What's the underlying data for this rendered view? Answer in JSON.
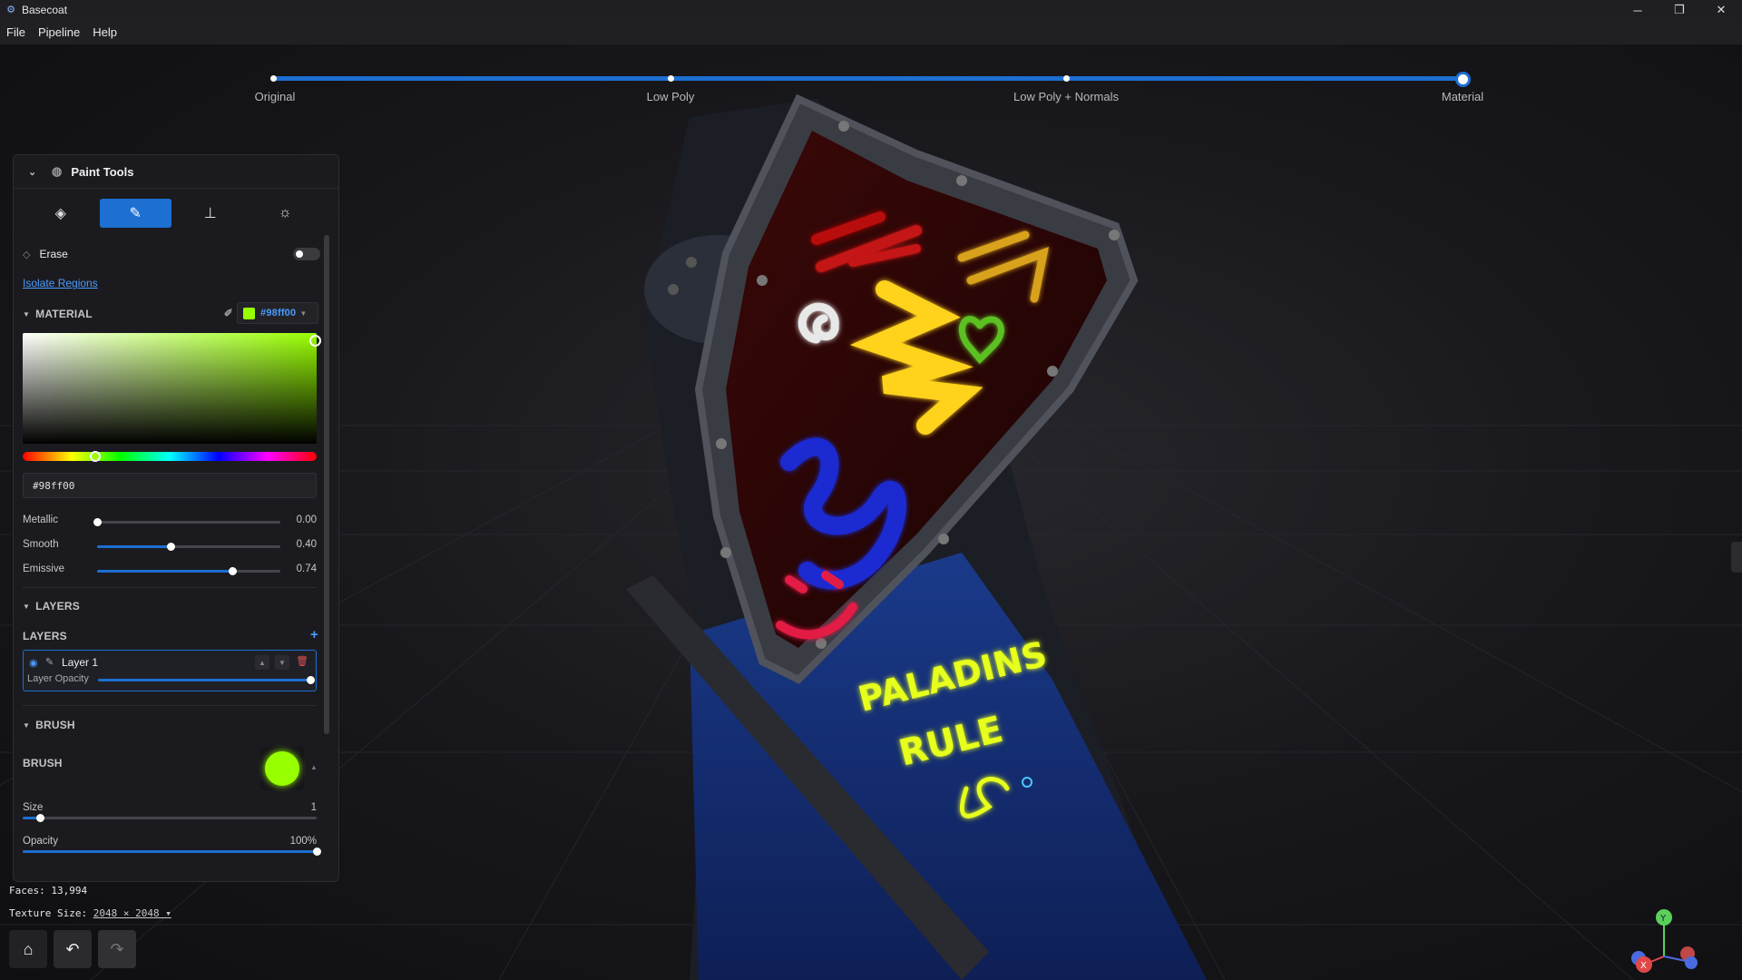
{
  "window": {
    "title": "Basecoat",
    "controls": {
      "minimize": "─",
      "restore": "❐",
      "close": "✕"
    }
  },
  "menu": [
    "File",
    "Pipeline",
    "Help"
  ],
  "pipeline": {
    "steps": [
      "Original",
      "Low Poly",
      "Low Poly + Normals",
      "Material"
    ],
    "active": "Material"
  },
  "panel": {
    "title": "Paint Tools",
    "tools": [
      {
        "name": "fill-bucket-icon",
        "glyph": "◈",
        "active": false
      },
      {
        "name": "brush-icon",
        "glyph": "✎",
        "active": true
      },
      {
        "name": "stamp-icon",
        "glyph": "⊥",
        "active": false
      },
      {
        "name": "light-icon",
        "glyph": "☼",
        "active": false
      }
    ],
    "erase": {
      "label": "Erase",
      "on": false
    },
    "isolate_regions": "Isolate Regions",
    "material": {
      "header": "MATERIAL",
      "color_hex": "#98ff00",
      "hex_input_value": "#98ff00",
      "hue_fraction": 0.22,
      "sliders": [
        {
          "label": "Metallic",
          "value": 0.0,
          "display": "0.00"
        },
        {
          "label": "Smooth",
          "value": 0.4,
          "display": "0.40"
        },
        {
          "label": "Emissive",
          "value": 0.74,
          "display": "0.74"
        }
      ]
    },
    "layers": {
      "header": "LAYERS",
      "sub_label": "LAYERS",
      "add_label": "+",
      "items": [
        {
          "name": "Layer 1",
          "opacity_label": "Layer Opacity",
          "opacity": 1.0
        }
      ]
    },
    "brush": {
      "header": "BRUSH",
      "sub_label": "BRUSH",
      "color": "#98ff00",
      "size": {
        "label": "Size",
        "value": 1,
        "display": "1"
      },
      "opacity": {
        "label": "Opacity",
        "value": 1.0,
        "display": "100%"
      }
    }
  },
  "stats": {
    "faces_label": "Faces:",
    "faces": "13,994",
    "texture_label": "Texture Size:",
    "texture": "2048 × 2048 ▾"
  },
  "scene_text": {
    "line1": "PALADINS",
    "line2": "RULE"
  },
  "gizmo": {
    "y": "Y",
    "x": "X"
  },
  "colors": {
    "accent": "#1d6fd1",
    "link": "#4a9bff",
    "delete": "#e05252"
  }
}
